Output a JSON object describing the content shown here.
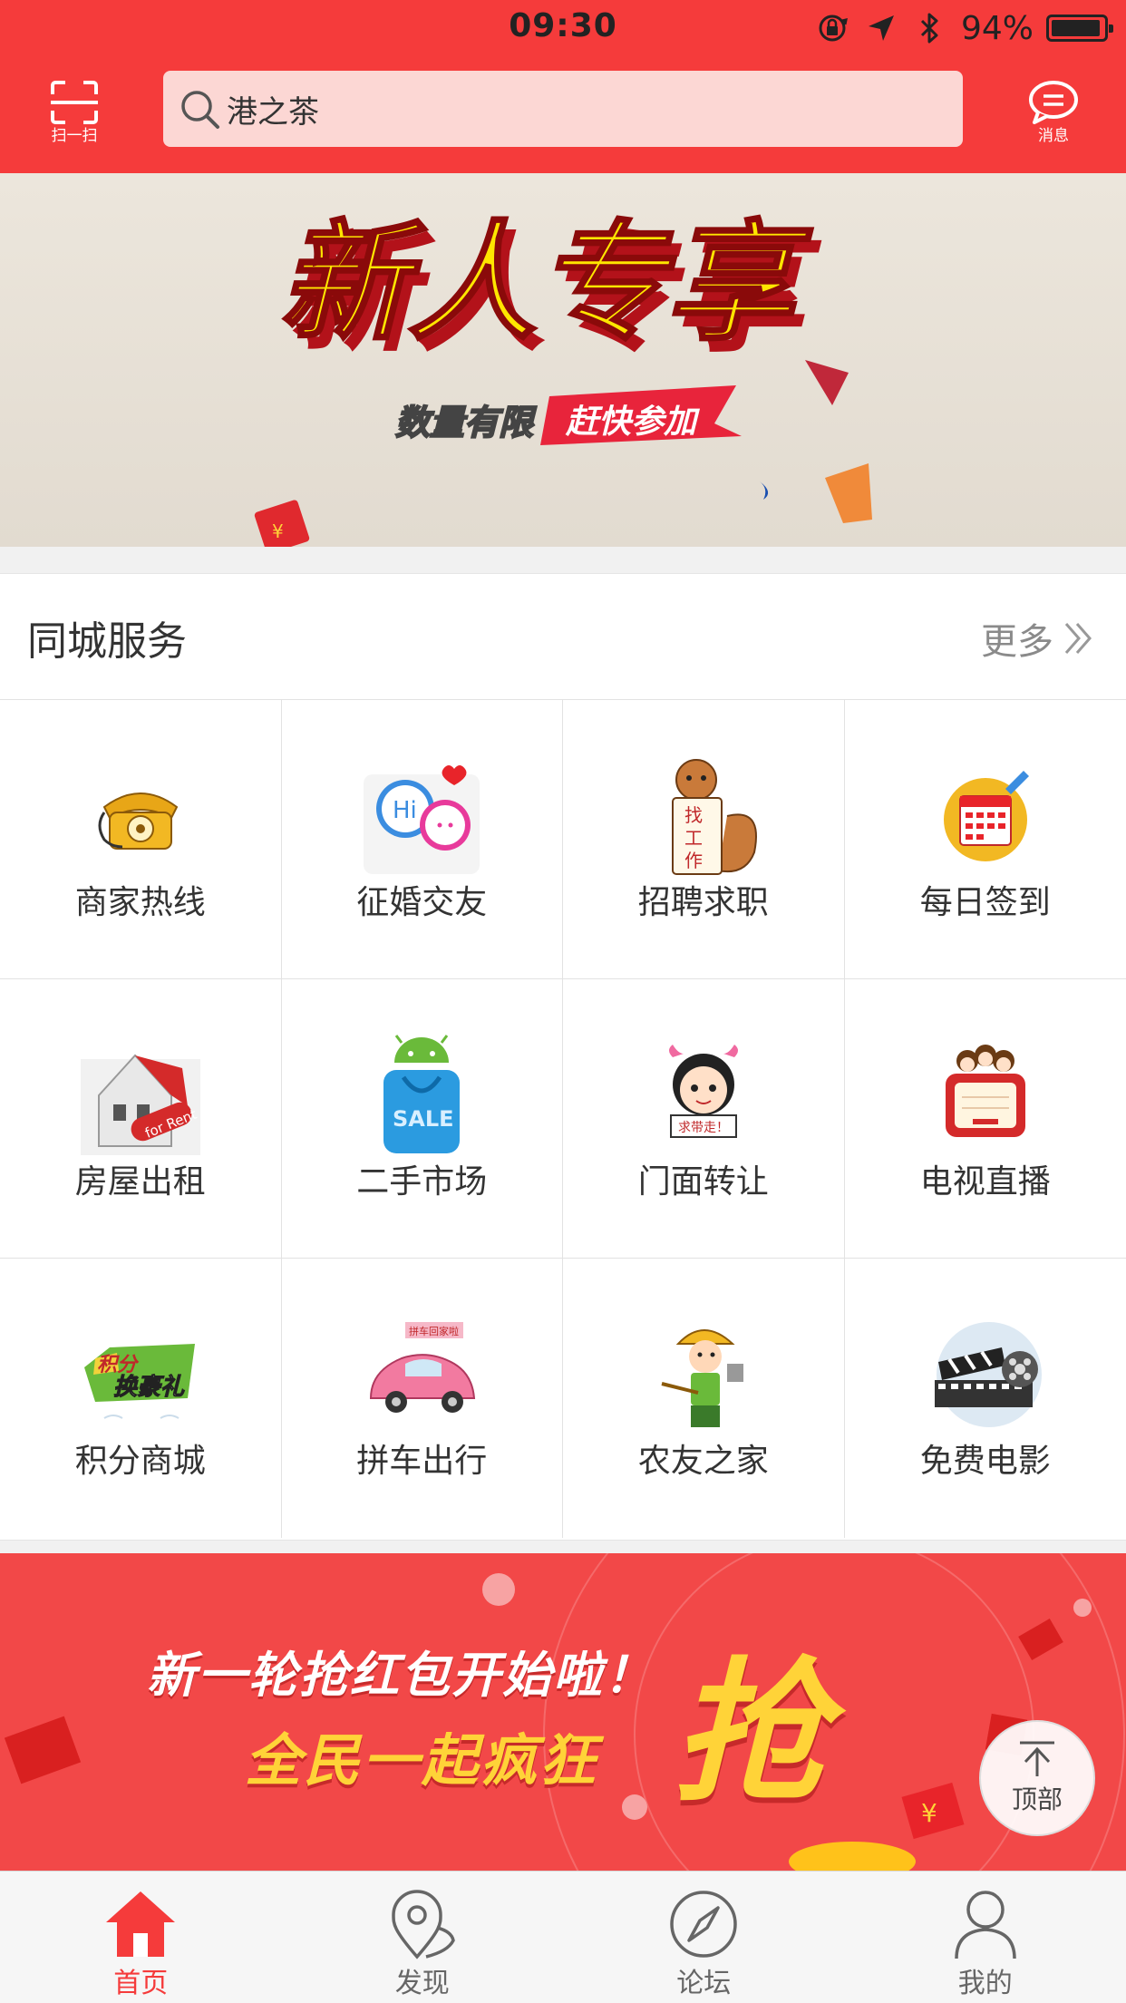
{
  "status_bar": {
    "time": "09:30",
    "battery_text": "94%",
    "battery_level": 0.94
  },
  "header": {
    "scan_label": "扫一扫",
    "search_value": "港之茶",
    "message_label": "消息",
    "accent_color": "#f53b3b"
  },
  "top_banner": {
    "headline": "新人专享",
    "sub_left": "数量有限",
    "sub_right": "赶快参加"
  },
  "services": {
    "title": "同城服务",
    "more_label": "更多",
    "items": [
      {
        "label": "商家热线",
        "icon": "telephone-icon"
      },
      {
        "label": "征婚交友",
        "icon": "chat-bubbles-icon"
      },
      {
        "label": "招聘求职",
        "icon": "squirrel-job-icon"
      },
      {
        "label": "每日签到",
        "icon": "calendar-icon"
      },
      {
        "label": "房屋出租",
        "icon": "house-for-rent-icon"
      },
      {
        "label": "二手市场",
        "icon": "sale-bag-icon"
      },
      {
        "label": "门面转让",
        "icon": "cartoon-girl-icon"
      },
      {
        "label": "电视直播",
        "icon": "tv-icon"
      },
      {
        "label": "积分商城",
        "icon": "points-gift-icon"
      },
      {
        "label": "拼车出行",
        "icon": "pink-car-icon"
      },
      {
        "label": "农友之家",
        "icon": "farmer-icon"
      },
      {
        "label": "免费电影",
        "icon": "film-clapper-icon"
      }
    ],
    "tiny_text": {
      "job_sign": "找工作",
      "for_rent": "for Rent",
      "sale": "SALE",
      "hi": "Hi",
      "girl_sign": "求带走！",
      "points_line1": "积分",
      "points_line2": "换豪礼",
      "carpool_sign": "拼车回家啦"
    }
  },
  "promo_banner": {
    "line1": "新一轮抢红包开始啦！",
    "line2": "全民一起疯狂",
    "grab": "抢"
  },
  "to_top": {
    "label": "顶部"
  },
  "tabbar": {
    "tabs": [
      {
        "label": "首页",
        "icon": "home-icon",
        "active": true
      },
      {
        "label": "发现",
        "icon": "location-pin-icon",
        "active": false
      },
      {
        "label": "论坛",
        "icon": "compass-icon",
        "active": false
      },
      {
        "label": "我的",
        "icon": "person-icon",
        "active": false
      }
    ]
  }
}
